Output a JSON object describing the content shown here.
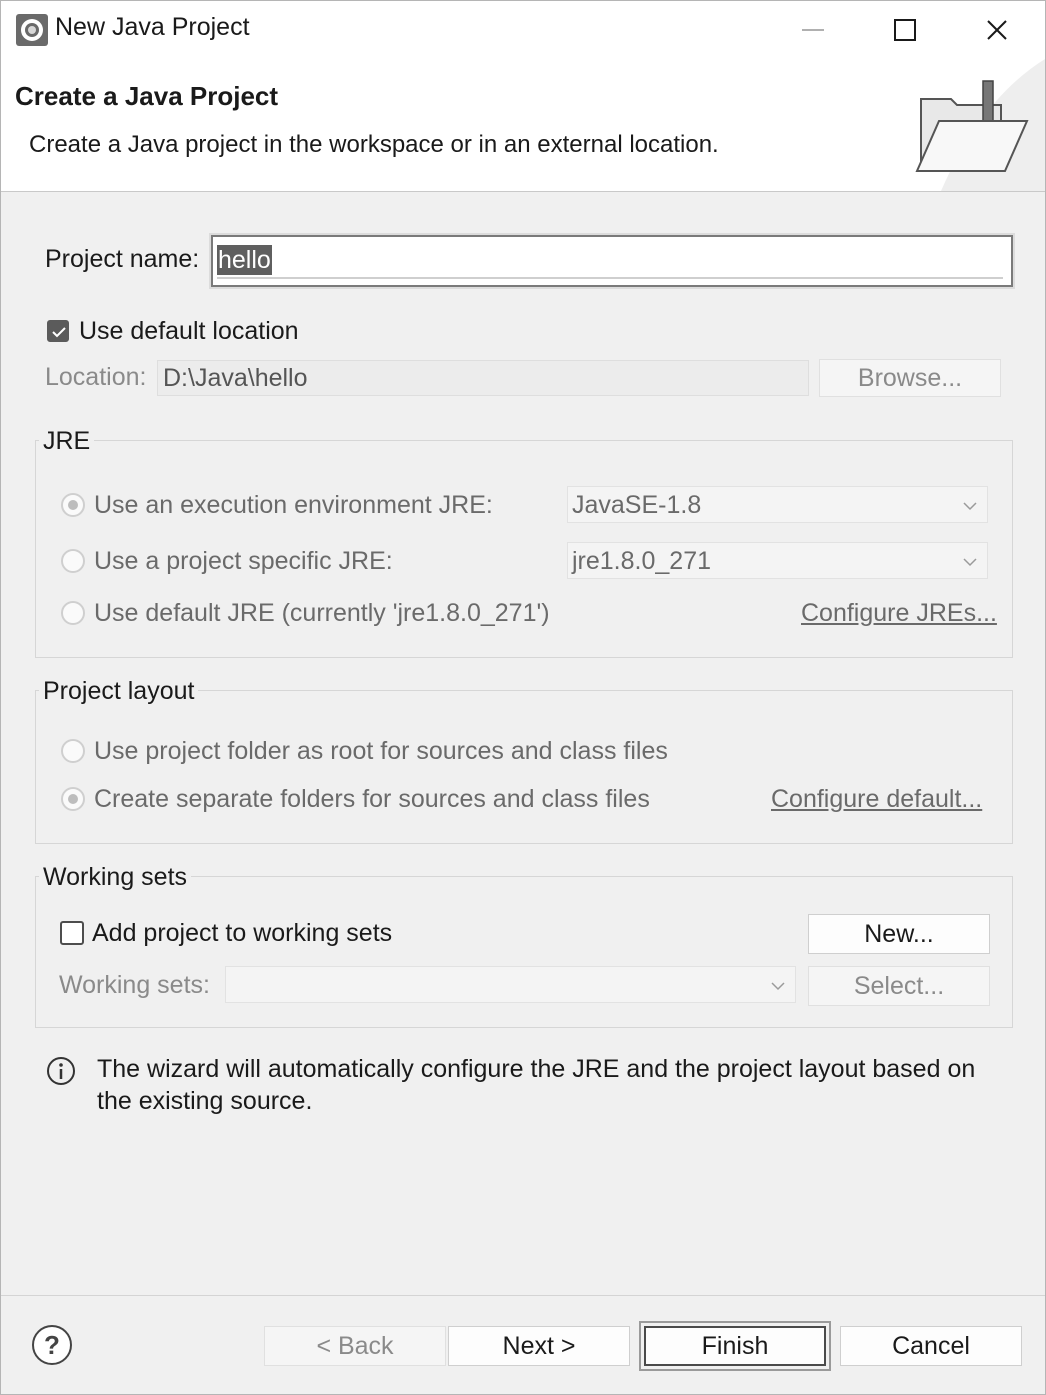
{
  "window": {
    "title": "New Java Project",
    "controls": {
      "minimize": "minimize-icon",
      "maximize": "maximize-icon",
      "close": "close-icon"
    }
  },
  "banner": {
    "title": "Create a Java Project",
    "description": "Create a Java project in the workspace or in an external location.",
    "image_icon": "folder-wizard-icon"
  },
  "project": {
    "name_label": "Project name:",
    "name_value": "hello",
    "use_default_location_label": "Use default location",
    "use_default_location_checked": true,
    "location_label": "Location:",
    "location_value": "D:\\Java\\hello",
    "browse_label": "Browse..."
  },
  "jre": {
    "group_title": "JRE",
    "options": [
      {
        "label": "Use an execution environment JRE:",
        "selected": true
      },
      {
        "label": "Use a project specific JRE:",
        "selected": false
      },
      {
        "label": "Use default JRE (currently 'jre1.8.0_271')",
        "selected": false
      }
    ],
    "execution_env_value": "JavaSE-1.8",
    "project_specific_value": "jre1.8.0_271",
    "configure_link": "Configure JREs..."
  },
  "layout": {
    "group_title": "Project layout",
    "options": [
      {
        "label": "Use project folder as root for sources and class files",
        "selected": false
      },
      {
        "label": "Create separate folders for sources and class files",
        "selected": true
      }
    ],
    "configure_link": "Configure default..."
  },
  "working_sets": {
    "group_title": "Working sets",
    "add_label": "Add project to working sets",
    "add_checked": false,
    "new_button": "New...",
    "sets_label": "Working sets:",
    "sets_value": "",
    "select_button": "Select..."
  },
  "info": {
    "icon": "info-icon",
    "message": "The wizard will automatically configure the JRE and the project layout based on the existing source."
  },
  "footer": {
    "help_icon": "help-icon",
    "back": "< Back",
    "next": "Next >",
    "finish": "Finish",
    "cancel": "Cancel"
  }
}
